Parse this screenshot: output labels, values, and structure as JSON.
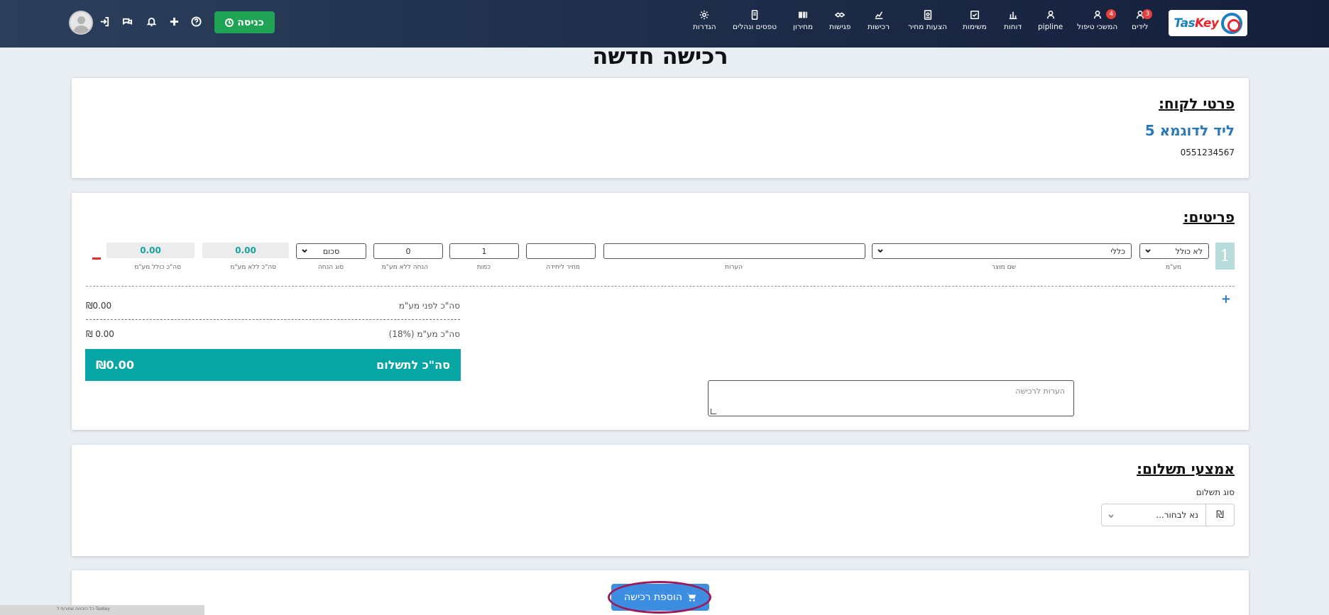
{
  "nav": {
    "logo_text_a": "Tas",
    "logo_text_b": "Key",
    "items": [
      {
        "label": "לידים",
        "icon": "users-icon",
        "badge": "3"
      },
      {
        "label": "המשכי טיפול",
        "icon": "users-icon",
        "badge": "4"
      },
      {
        "label": "pipline",
        "icon": "users-icon",
        "badge": ""
      },
      {
        "label": "דוחות",
        "icon": "chart-icon",
        "badge": ""
      },
      {
        "label": "משימות",
        "icon": "check-icon",
        "badge": ""
      },
      {
        "label": "הצעות מחיר",
        "icon": "document-icon",
        "badge": ""
      },
      {
        "label": "רכישות",
        "icon": "trend-icon",
        "badge": ""
      },
      {
        "label": "פגישות",
        "icon": "handshake-icon",
        "badge": ""
      },
      {
        "label": "מחירון",
        "icon": "barcode-icon",
        "badge": ""
      },
      {
        "label": "טפסים ונהלים",
        "icon": "form-icon",
        "badge": ""
      },
      {
        "label": "הגדרות",
        "icon": "gear-icon",
        "badge": ""
      }
    ],
    "enter_label": "כניסה"
  },
  "page": {
    "title": "רכישה חדשה"
  },
  "customer": {
    "section_title": "פרטי לקוח:",
    "name": "ליד לדוגמא 5",
    "phone": "0551234567"
  },
  "items": {
    "section_title": "פריטים:",
    "row_number": "1",
    "vat_value": "לא כולל",
    "product_value": "כללי",
    "notes_value": "",
    "unit_price_value": "",
    "quantity_value": "1",
    "discount_value": "0",
    "discount_type_value": "סכום",
    "total_no_vat": "0.00",
    "total_with_vat": "0.00",
    "labels": {
      "vat": "מע\"מ",
      "product": "שם מוצר",
      "notes": "הערות",
      "unit_price": "מחיר ליחידה",
      "quantity": "כמות",
      "discount": "הנחה ללא מע\"מ",
      "discount_type": "סוג הנחה",
      "total_no_vat": "סה\"כ ללא מע\"מ",
      "total_with_vat": "סה\"כ כולל מע\"מ"
    },
    "add_symbol": "+"
  },
  "summary": {
    "before_vat_label": "סה\"כ לפני מע\"מ",
    "before_vat_amount": "₪0.00",
    "vat_label": "סה\"כ מע\"מ (18%)",
    "vat_amount": "₪ 0.00",
    "total_label": "סה\"כ לתשלום",
    "total_amount": "₪0.00",
    "notes_placeholder": "הערות לרכישה"
  },
  "payment": {
    "section_title": "אמצעי תשלום:",
    "type_label": "סוג תשלום",
    "currency_symbol": "₪",
    "select_placeholder": "נא לבחור..."
  },
  "submit": {
    "label": "הוספת רכישה"
  },
  "footer": {
    "text": "כל הזכויות שמורות ל-TasKey"
  },
  "colors": {
    "accent": "#08a5a5",
    "brand_blue": "#2b79ba",
    "nav_bg": "#1d2c48",
    "green": "#1fa455"
  }
}
